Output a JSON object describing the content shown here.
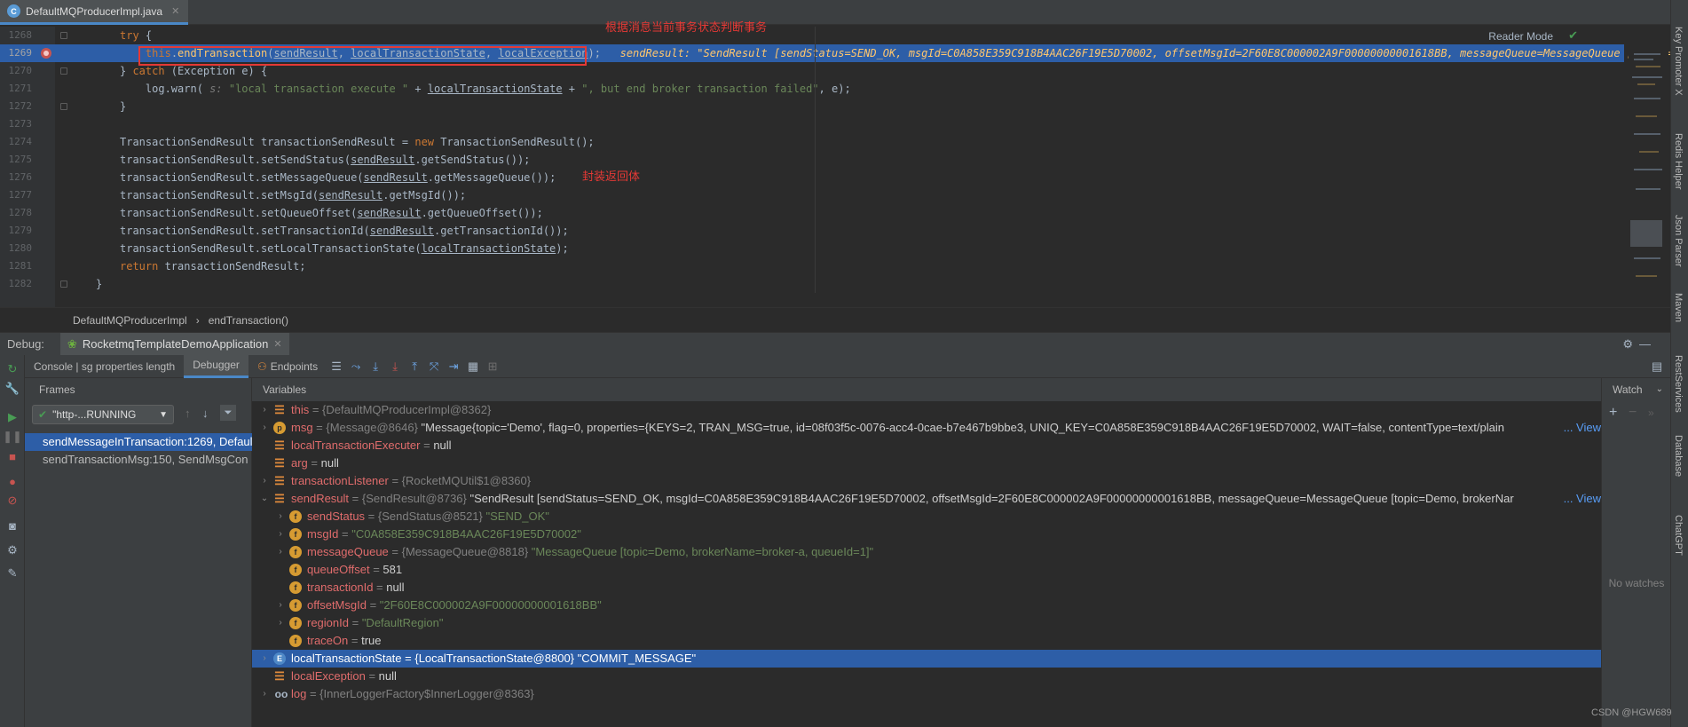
{
  "tab": {
    "file": "DefaultMQProducerImpl.java"
  },
  "editor": {
    "reader_mode": "Reader Mode",
    "annotation_top": "根据消息当前事务状态判断事务",
    "annotation_mid": "封装返回体",
    "lines": [
      {
        "n": "1268",
        "html": "<span class='k'>try</span> {"
      },
      {
        "n": "1269",
        "html": "    <span class='k'>this</span>.<span class='f'>endTransaction</span>(<span class='u'>sendResult</span>, <span class='u'>localTransactionState</span>, <span class='u'>localException</span>);   <span class='inl'>sendResult: \"SendResult [sendStatus=SEND_OK, msgId=C0A858E359C918B4AAC26F19E5D70002, offsetMsgId=2F60E8C000002A9F00000000001618BB, messageQueue=MessageQueue [topic=D</span>"
      },
      {
        "n": "1270",
        "html": "} <span class='k'>catch</span> (Exception e) {"
      },
      {
        "n": "1271",
        "html": "    log.warn( <span class='i'>s:</span> <span class='s'>\"local transaction execute \"</span> + <span class='u'>localTransactionState</span> + <span class='s'>\", but end broker transaction failed\"</span>, e);"
      },
      {
        "n": "1272",
        "html": "}"
      },
      {
        "n": "1273",
        "html": ""
      },
      {
        "n": "1274",
        "html": "TransactionSendResult transactionSendResult = <span class='k'>new</span> TransactionSendResult();"
      },
      {
        "n": "1275",
        "html": "transactionSendResult.setSendStatus(<span class='u'>sendResult</span>.getSendStatus());"
      },
      {
        "n": "1276",
        "html": "transactionSendResult.setMessageQueue(<span class='u'>sendResult</span>.getMessageQueue());"
      },
      {
        "n": "1277",
        "html": "transactionSendResult.setMsgId(<span class='u'>sendResult</span>.getMsgId());"
      },
      {
        "n": "1278",
        "html": "transactionSendResult.setQueueOffset(<span class='u'>sendResult</span>.getQueueOffset());"
      },
      {
        "n": "1279",
        "html": "transactionSendResult.setTransactionId(<span class='u'>sendResult</span>.getTransactionId());"
      },
      {
        "n": "1280",
        "html": "transactionSendResult.setLocalTransactionState(<span class='u'>localTransactionState</span>);"
      },
      {
        "n": "1281",
        "html": "<span class='k'>return</span> transactionSendResult;"
      },
      {
        "n": "1282",
        "html": "}"
      }
    ]
  },
  "breadcrumb": {
    "class": "DefaultMQProducerImpl",
    "method": "endTransaction()"
  },
  "debug": {
    "label": "Debug:",
    "config": "RocketmqTemplateDemoApplication",
    "tabs": {
      "console": "Console | sg properties length",
      "debugger": "Debugger",
      "endpoints": "Endpoints"
    },
    "frames_header": "Frames",
    "thread": "\"http-...RUNNING",
    "frames": [
      "sendMessageInTransaction:1269, Defaul",
      "sendTransactionMsg:150, SendMsgCon"
    ],
    "variables_header": "Variables",
    "watch_header": "Watch",
    "no_watches": "No watches",
    "vars": [
      {
        "name": "this",
        "type": " = {DefaultMQProducerImpl@8362}",
        "val": ""
      },
      {
        "name": "msg",
        "type": " = {Message@8646} ",
        "val": "\"Message{topic='Demo', flag=0, properties={KEYS=2, TRAN_MSG=true, id=08f03f5c-0076-acc4-0cae-b7e467b9bbe3, UNIQ_KEY=C0A858E359C918B4AAC26F19E5D70002, WAIT=false, contentType=text/plain",
        "link": "... View"
      },
      {
        "name": "localTransactionExecuter",
        "type": " = ",
        "val": "null"
      },
      {
        "name": "arg",
        "type": " = ",
        "val": "null"
      },
      {
        "name": "transactionListener",
        "type": " = {RocketMQUtil$1@8360}",
        "val": ""
      },
      {
        "name": "sendResult",
        "type": " = {SendResult@8736} ",
        "val": "\"SendResult [sendStatus=SEND_OK, msgId=C0A858E359C918B4AAC26F19E5D70002, offsetMsgId=2F60E8C000002A9F00000000001618BB, messageQueue=MessageQueue [topic=Demo, brokerNar",
        "link": "... View"
      },
      {
        "name": "sendStatus",
        "type": " = {SendStatus@8521} ",
        "val": "\"SEND_OK\""
      },
      {
        "name": "msgId",
        "type": " = ",
        "val": "\"C0A858E359C918B4AAC26F19E5D70002\""
      },
      {
        "name": "messageQueue",
        "type": " = {MessageQueue@8818} ",
        "val": "\"MessageQueue [topic=Demo, brokerName=broker-a, queueId=1]\""
      },
      {
        "name": "queueOffset",
        "type": " = ",
        "val": "581"
      },
      {
        "name": "transactionId",
        "type": " = ",
        "val": "null"
      },
      {
        "name": "offsetMsgId",
        "type": " = ",
        "val": "\"2F60E8C000002A9F00000000001618BB\""
      },
      {
        "name": "regionId",
        "type": " = ",
        "val": "\"DefaultRegion\""
      },
      {
        "name": "traceOn",
        "type": " = ",
        "val": "true"
      },
      {
        "name": "localTransactionState",
        "type": " = {LocalTransactionState@8800} ",
        "val": "\"COMMIT_MESSAGE\""
      },
      {
        "name": "localException",
        "type": " = ",
        "val": "null"
      },
      {
        "name": "log",
        "type": " = {InnerLoggerFactory$InnerLogger@8363}",
        "val": ""
      }
    ]
  },
  "right_tools": [
    "Key Promoter X",
    "Redis Helper",
    "Json Parser",
    "Maven",
    "RestServices",
    "Database",
    "ChatGPT"
  ],
  "watermark": "CSDN @HGW689",
  "colors": {
    "accent": "#2d5ea7",
    "annotation": "#e53935",
    "variable_name": "#e06c6c"
  }
}
